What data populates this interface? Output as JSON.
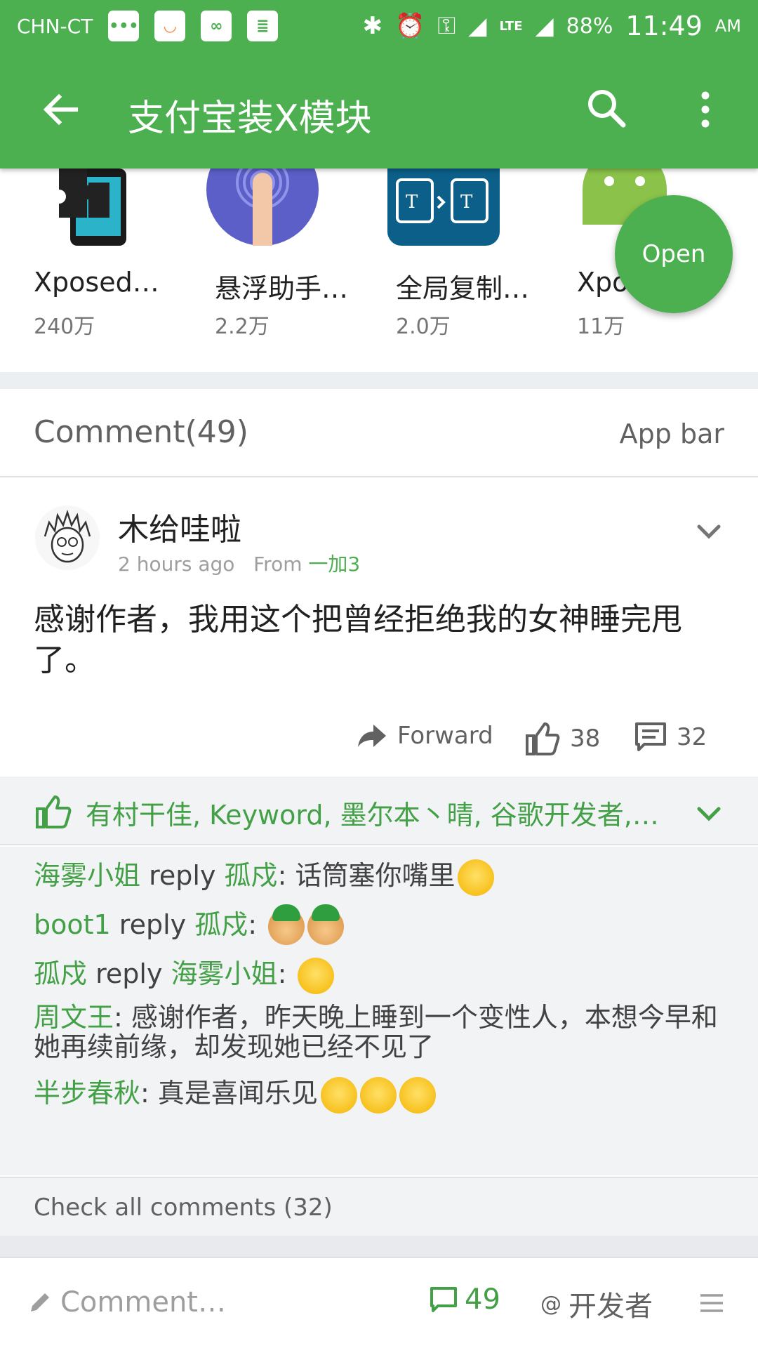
{
  "status_bar": {
    "carrier": "CHN-CT",
    "battery": "88%",
    "time": "11:49",
    "ampm": "AM",
    "network": "LTE"
  },
  "toolbar": {
    "title": "支付宝装X模块"
  },
  "apps": [
    {
      "name": "Xposed…",
      "count": "240万"
    },
    {
      "name": "悬浮助手…",
      "count": "2.2万"
    },
    {
      "name": "全局复制…",
      "count": "2.0万"
    },
    {
      "name": "Xpo",
      "count": "11万"
    }
  ],
  "fab_label": "Open",
  "comment_section": {
    "title": "Comment(49)",
    "right_label": "App bar"
  },
  "post": {
    "author": "木给哇啦",
    "time": "2 hours ago",
    "from_label": "From",
    "device": "一加3",
    "text": "感谢作者，我用这个把曾经拒绝我的女神睡完甩了。",
    "forward_label": "Forward",
    "like_count": "38",
    "comment_count": "32"
  },
  "likes": {
    "names": "有村干佳, Keyword, 墨尔本丶晴, 谷歌开发者,…"
  },
  "replies": [
    {
      "user": "海雾小姐",
      "reply_word": "reply",
      "target": "孤戍",
      "text": ": 话筒塞你嘴里"
    },
    {
      "user": "boot1",
      "reply_word": "reply",
      "target": "孤戍",
      "text": ":"
    },
    {
      "user": "孤戍",
      "reply_word": "reply",
      "target": "海雾小姐",
      "text": ":"
    },
    {
      "user": "周文王",
      "text": ": 感谢作者，昨天晚上睡到一个变性人，本想今早和她再续前缘，却发现她已经不见了"
    },
    {
      "user": "半步春秋",
      "text": ": 真是喜闻乐见"
    }
  ],
  "check_all": "Check all comments (32)",
  "bottom_bar": {
    "comment_placeholder": "Comment…",
    "count": "49",
    "at_label": "@",
    "developer": "开发者"
  },
  "colors": {
    "primary": "#4caf50",
    "accent_text": "#43a047",
    "grey_bg": "#f2f3f5"
  }
}
